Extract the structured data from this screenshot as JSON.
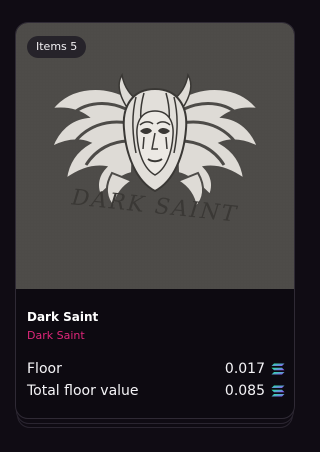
{
  "card": {
    "items_badge": "Items 5",
    "title": "Dark Saint",
    "collection": "Dark Saint",
    "collection_color": "#e0267a",
    "image_text": "DARK SAINT",
    "currency_icon": "solana-icon"
  },
  "stats": {
    "floor_label": "Floor",
    "floor_value": "0.017",
    "total_label": "Total floor value",
    "total_value": "0.085"
  }
}
